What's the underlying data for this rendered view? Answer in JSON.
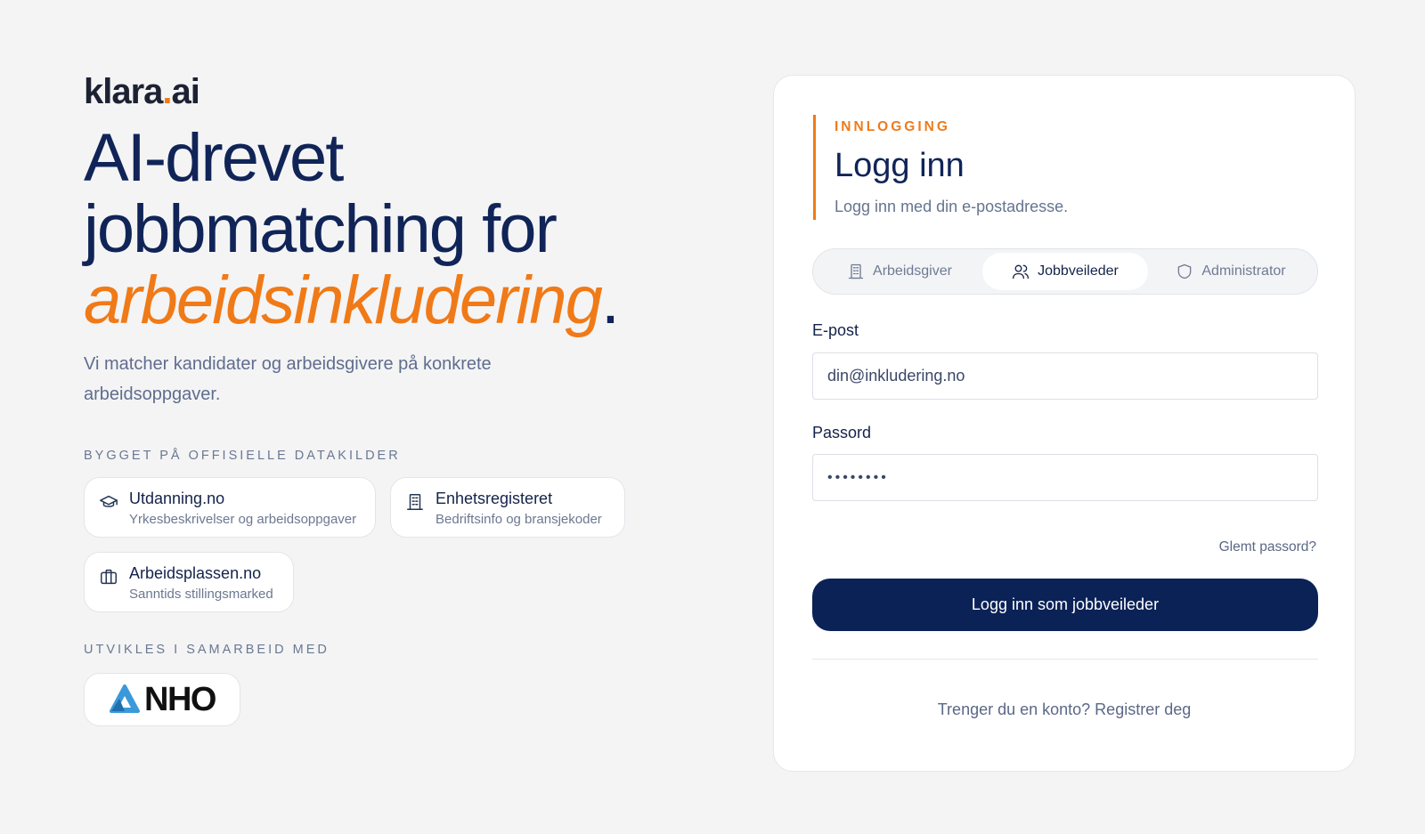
{
  "brand": {
    "name": "klara",
    "dot": ".",
    "tld": "ai"
  },
  "hero": {
    "line1": "AI-drevet",
    "line2": "jobbmatching for",
    "accent": "arbeidsinkludering",
    "period": ".",
    "subtitle": "Vi matcher kandidater og arbeidsgivere på konkrete arbeidsoppgaver."
  },
  "sources": {
    "label": "BYGGET PÅ OFFISIELLE DATAKILDER",
    "items": [
      {
        "title": "Utdanning.no",
        "desc": "Yrkesbeskrivelser og arbeidsoppgaver",
        "icon": "graduation-cap-icon"
      },
      {
        "title": "Enhetsregisteret",
        "desc": "Bedriftsinfo og bransjekoder",
        "icon": "building-icon"
      },
      {
        "title": "Arbeidsplassen.no",
        "desc": "Sanntids stillingsmarked",
        "icon": "briefcase-icon"
      }
    ]
  },
  "partner": {
    "label": "UTVIKLES I SAMARBEID MED",
    "name": "NHO"
  },
  "login": {
    "eyebrow": "INNLOGGING",
    "title": "Logg inn",
    "subtitle": "Logg inn med din e-postadresse.",
    "roles": [
      {
        "label": "Arbeidsgiver",
        "icon": "building-icon",
        "active": false
      },
      {
        "label": "Jobbveileder",
        "icon": "users-icon",
        "active": true
      },
      {
        "label": "Administrator",
        "icon": "shield-icon",
        "active": false
      }
    ],
    "email_label": "E-post",
    "email_value": "din@inkludering.no",
    "password_label": "Passord",
    "password_value": "••••••••",
    "forgot": "Glemt passord?",
    "submit": "Logg inn som jobbveileder",
    "register": "Trenger du en konto? Registrer deg"
  },
  "colors": {
    "accent": "#f07a17",
    "navy": "#0b2257",
    "background": "#f4f4f5"
  }
}
